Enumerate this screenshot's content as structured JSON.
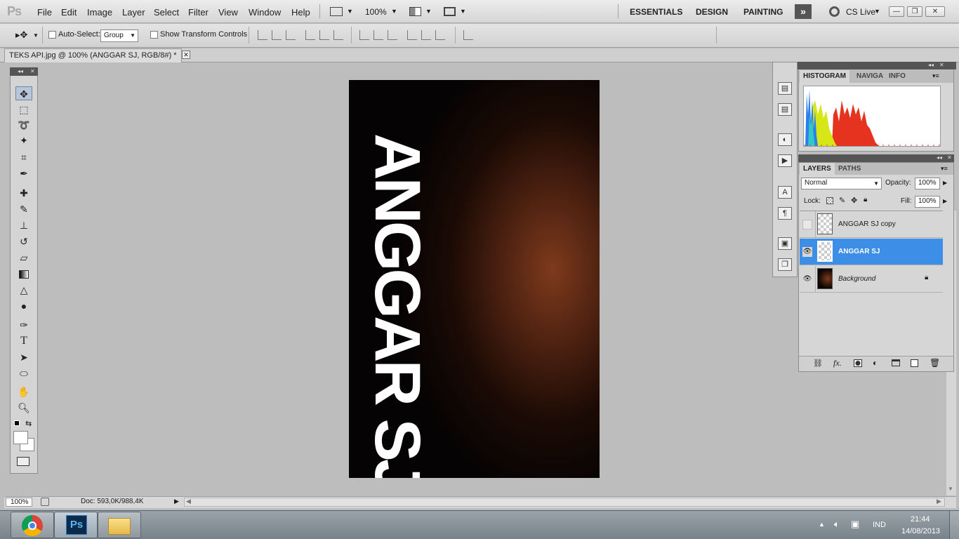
{
  "app": {
    "logo": "Ps"
  },
  "menu": [
    "File",
    "Edit",
    "Image",
    "Layer",
    "Select",
    "Filter",
    "View",
    "Window",
    "Help"
  ],
  "menubar": {
    "zoom": "100%",
    "workspaces": [
      "ESSENTIALS",
      "DESIGN",
      "PAINTING"
    ],
    "cs_live": "CS Live"
  },
  "options": {
    "auto_select_label": "Auto-Select:",
    "auto_select_value": "Group",
    "show_transform_label": "Show Transform Controls"
  },
  "document": {
    "tab_title": "TEKS API.jpg @ 100% (ANGGAR SJ, RGB/8#) *",
    "canvas_text": "ANGGAR SJ"
  },
  "histogram_panel": {
    "tabs": [
      "HISTOGRAM",
      "NAVIGA",
      "INFO"
    ]
  },
  "layers_panel": {
    "tabs": [
      "LAYERS",
      "PATHS"
    ],
    "blend_mode": "Normal",
    "opacity_label": "Opacity:",
    "opacity": "100%",
    "lock_label": "Lock:",
    "fill_label": "Fill:",
    "fill": "100%",
    "layers": [
      {
        "name": "ANGGAR SJ copy",
        "visible": false,
        "selected": false
      },
      {
        "name": "ANGGAR SJ",
        "visible": true,
        "selected": true
      },
      {
        "name": "Background",
        "visible": true,
        "selected": false,
        "locked": true
      }
    ]
  },
  "status": {
    "zoom": "100%",
    "doc": "Doc: 593,0K/988,4K"
  },
  "taskbar": {
    "lang": "IND",
    "time": "21:44",
    "date": "14/08/2013"
  },
  "colors": {
    "selection": "#3d8ee6",
    "canvas_glow": "#7e3a1c"
  }
}
